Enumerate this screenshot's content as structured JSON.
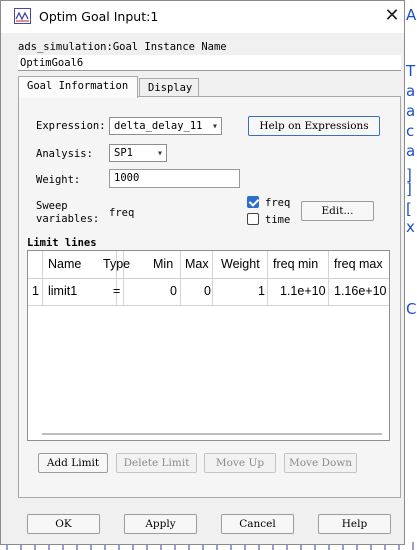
{
  "window": {
    "title": "Optim Goal Input:1"
  },
  "instance": {
    "label": "ads_simulation:Goal Instance Name",
    "value": "OptimGoal6"
  },
  "tabs": [
    {
      "label": "Goal Information"
    },
    {
      "label": "Display"
    }
  ],
  "goal": {
    "expression_label": "Expression:",
    "expression_value": "delta_delay_11",
    "help_button": "Help on Expressions",
    "analysis_label": "Analysis:",
    "analysis_value": "SP1",
    "weight_label": "Weight:",
    "weight_value": "1000",
    "sweep_label_1": "Sweep",
    "sweep_label_2": "variables:",
    "sweep_value": "freq",
    "check_freq": "freq",
    "check_time": "time",
    "edit_button": "Edit..."
  },
  "limits": {
    "section_title": "Limit lines",
    "columns": [
      "Name",
      "Type",
      "Min",
      "Max",
      "Weight",
      "freq min",
      "freq max"
    ],
    "rows": [
      {
        "index": "1",
        "name": "limit1",
        "type": "=",
        "min": "0",
        "max": "0",
        "weight": "1",
        "freq_min": "1.1e+10",
        "freq_max": "1.16e+10"
      }
    ],
    "add_button": "Add Limit",
    "delete_button": "Delete Limit",
    "up_button": "Move Up",
    "down_button": "Move Down"
  },
  "footer": {
    "ok": "OK",
    "apply": "Apply",
    "cancel": "Cancel",
    "help": "Help"
  },
  "colors": {
    "accent": "#2c6fc9",
    "focus_border": "#3b6fb6"
  }
}
